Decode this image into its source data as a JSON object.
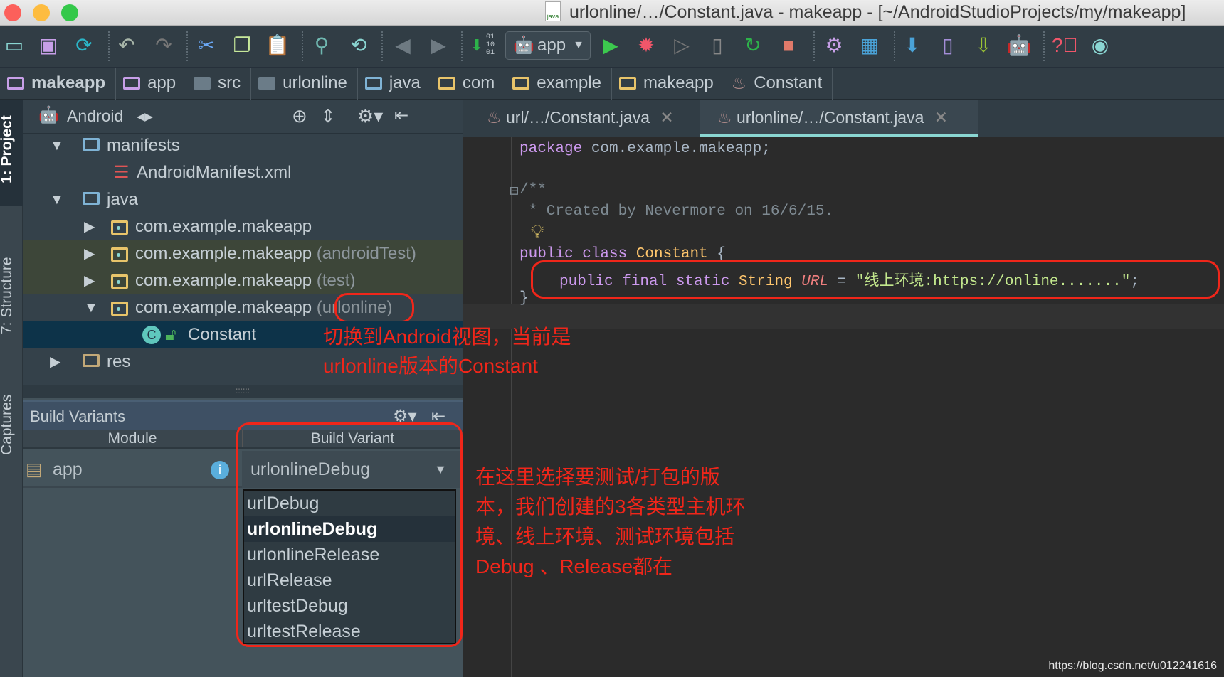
{
  "window": {
    "title": "urlonline/…/Constant.java - makeapp - [~/AndroidStudioProjects/my/makeapp]",
    "file_icon_label": "java"
  },
  "toolbar": {
    "run_config": "app",
    "binary_label": "01\n10\n01"
  },
  "breadcrumb": [
    "makeapp",
    "app",
    "src",
    "urlonline",
    "java",
    "com",
    "example",
    "makeapp",
    "Constant"
  ],
  "side_tabs": {
    "project": "1: Project",
    "structure": "7: Structure",
    "captures": "Captures"
  },
  "project_panel": {
    "view": "Android",
    "tree": [
      {
        "label": "manifests",
        "suffix": ""
      },
      {
        "label": "AndroidManifest.xml",
        "suffix": ""
      },
      {
        "label": "java",
        "suffix": ""
      },
      {
        "label": "com.example.makeapp",
        "suffix": ""
      },
      {
        "label": "com.example.makeapp",
        "suffix": "(androidTest)"
      },
      {
        "label": "com.example.makeapp",
        "suffix": "(test)"
      },
      {
        "label": "com.example.makeapp",
        "suffix": "(urlonline)"
      },
      {
        "label": "Constant",
        "suffix": ""
      },
      {
        "label": "res",
        "suffix": ""
      }
    ]
  },
  "build_variants": {
    "title": "Build Variants",
    "col_module": "Module",
    "col_variant": "Build Variant",
    "module": "app",
    "selected": "urlonlineDebug",
    "options": [
      "urlDebug",
      "urlonlineDebug",
      "urlonlineRelease",
      "urlRelease",
      "urltestDebug",
      "urltestRelease"
    ]
  },
  "editor": {
    "tabs": [
      {
        "label": "url/…/Constant.java",
        "active": false
      },
      {
        "label": "urlonline/…/Constant.java",
        "active": true
      }
    ],
    "code": {
      "package_kw": "package",
      "package_name": " com.example.makeapp;",
      "doc_open": "/**",
      "doc_line": " * Created by Nevermore on 16/6/15.",
      "class_kw": "public class ",
      "class_name": "Constant",
      "class_open": " {",
      "field_mods": "public final static ",
      "field_type": "String ",
      "field_name": "URL",
      "field_eq": " = ",
      "field_value": "\"线上环境:https://online.......\"",
      "field_end": ";",
      "close": "}"
    }
  },
  "annotations": {
    "tree_note_1": "切换到Android视图，当前是",
    "tree_note_2": "urlonline版本的Constant",
    "variant_note": [
      "在这里选择要测试/打包的版",
      "本，我们创建的3各类型主机环",
      "境、线上环境、测试环境包括",
      "Debug 、Release都在"
    ]
  },
  "watermark": "https://blog.csdn.net/u012241616",
  "colors": {
    "annotation": "#f0261a",
    "tab_underline": "#8ad6d2",
    "selection": "#0d3349"
  }
}
